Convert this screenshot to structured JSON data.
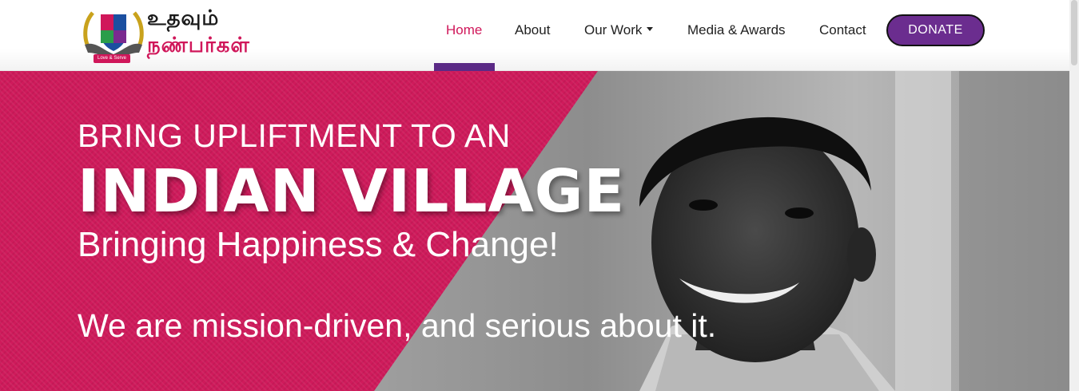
{
  "logo": {
    "line1": "உதவும்",
    "line2": "நண்பர்கள்",
    "tagline": "Love & Serve",
    "icon": "hands-shield-logo"
  },
  "nav": {
    "items": [
      {
        "label": "Home",
        "active": true
      },
      {
        "label": "About",
        "active": false
      },
      {
        "label": "Our Work",
        "active": false,
        "dropdown": true
      },
      {
        "label": "Media & Awards",
        "active": false
      },
      {
        "label": "Contact",
        "active": false
      }
    ],
    "donate_label": "DONATE"
  },
  "hero": {
    "line1": "BRING UPLIFTMENT TO AN",
    "line2": "INDIAN VILLAGE",
    "line3": "Bringing Happiness & Change!",
    "line4": "We are mission-driven, and serious about it.",
    "image": "smiling-boy-photo"
  },
  "colors": {
    "brand_pink": "#d0175a",
    "brand_purple": "#6b2d8f",
    "active_bar": "#5b2a86"
  }
}
